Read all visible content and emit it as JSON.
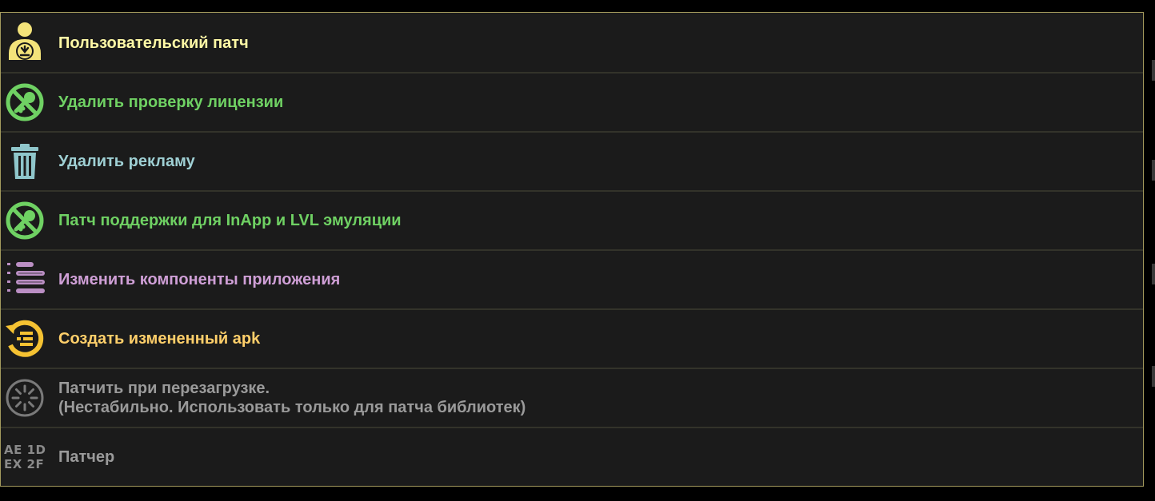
{
  "menu": {
    "items": [
      {
        "label": "Пользовательский патч",
        "color": "#fff9a6",
        "icon": "person-download-icon"
      },
      {
        "label": "Удалить проверку лицензии",
        "color": "#6fd163",
        "icon": "no-key-icon"
      },
      {
        "label": "Удалить рекламу",
        "color": "#9fd0d4",
        "icon": "trash-icon"
      },
      {
        "label": "Патч поддержки для InApp и LVL эмуляции",
        "color": "#6fd163",
        "icon": "no-key-icon"
      },
      {
        "label": "Изменить компоненты приложения",
        "color": "#cf9fd6",
        "icon": "components-list-icon"
      },
      {
        "label": "Создать измененный apk",
        "color": "#ffcf6a",
        "icon": "rebuild-apk-icon"
      },
      {
        "label_line1": "Патчить при перезагрузке.",
        "label_line2": "(Нестабильно. Использовать только для патча библиотек)",
        "color": "#9a9a9a",
        "icon": "loading-spinner-icon"
      },
      {
        "label": "Патчер",
        "color": "#9a9a9a",
        "icon": "hex-code-icon",
        "hex_line1": "AE 1D",
        "hex_line2": "EX 2F"
      }
    ]
  }
}
